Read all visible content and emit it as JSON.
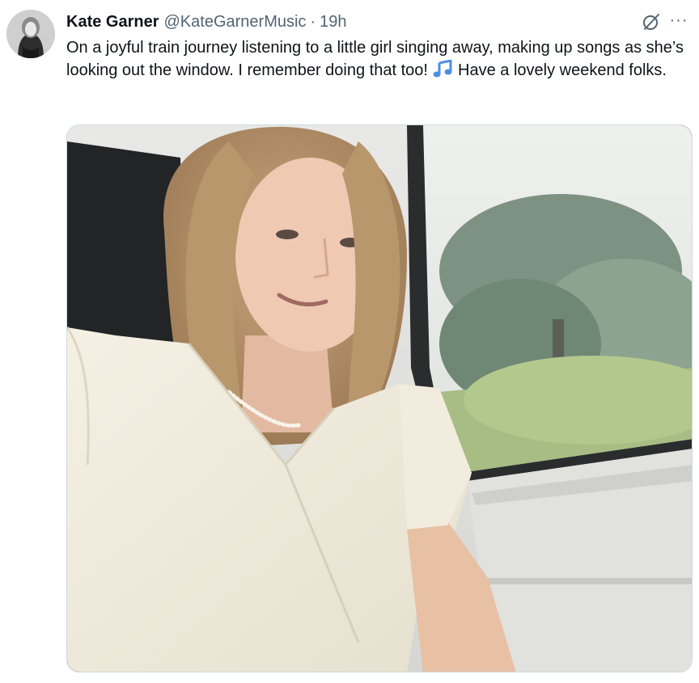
{
  "tweet": {
    "author_name": "Kate Garner",
    "handle": "@KateGarnerMusic",
    "separator": "·",
    "time": "19h",
    "text_part1": "On a joyful train journey listening to a little girl singing away, making up songs as she’s looking out the window. I remember doing that too! ",
    "text_emoji": "musical-notes-emoji",
    "text_part2": " Have a lovely weekend folks.",
    "more_label": "···",
    "icons": {
      "grok": "grok-icon",
      "more": "more-icon"
    }
  },
  "colors": {
    "text_primary": "#0f1419",
    "text_secondary": "#536471",
    "emoji_blue": "#4a90e2"
  }
}
